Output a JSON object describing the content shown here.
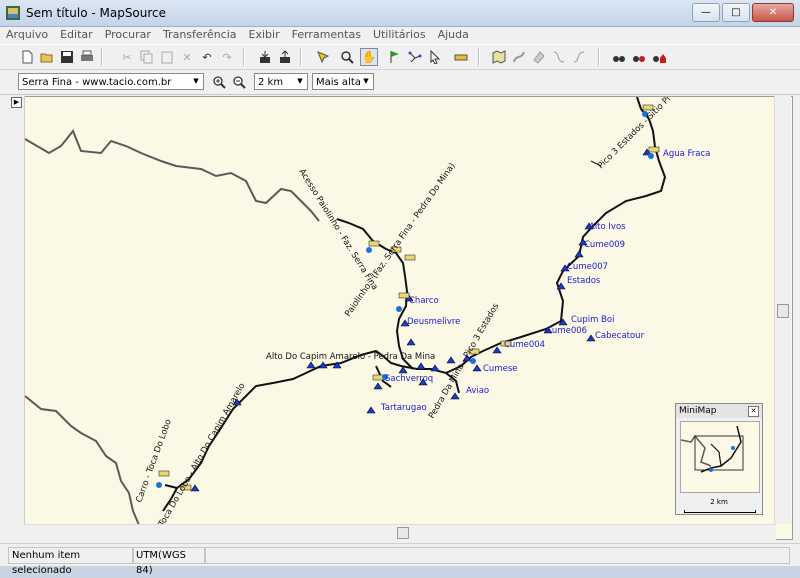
{
  "window": {
    "title": "Sem título - MapSource"
  },
  "menu": [
    "Arquivo",
    "Editar",
    "Procurar",
    "Transferência",
    "Exibir",
    "Ferramentas",
    "Utilitários",
    "Ajuda"
  ],
  "toolbar2": {
    "map_product": "Serra Fina - www.tacio.com.br",
    "zoom_scale": "2 km",
    "detail": "Mais alta"
  },
  "status": {
    "selection": "Nenhum item selecionado",
    "datum": "UTM(WGS 84)"
  },
  "minimap": {
    "title": "MiniMap",
    "scale": "2 km"
  },
  "waypoints": [
    "Agua Fraca",
    "Alto Ivos",
    "Cume009",
    "Cume007",
    "Estados",
    "Cupim Boi",
    "Cume006",
    "Cabecatour",
    "Cume004",
    "Cumese",
    "Aviao",
    "Tartarugao",
    "Sachverroq",
    "Charco",
    "Deusmelivre"
  ],
  "track_labels": {
    "pico3estados": "Pico 3 Estados - Sitio Pi",
    "acesso": "Acesso Paiolinho - Faz. Serra Fina",
    "paiolinho": "Paiolinho - (Faz. Serra Fina - Pedra Do Mina)",
    "capim": "Alto Do Capim Amarelo - Pedra Da Mina",
    "pedra3est": "Pedra Da Mina - Pico 3 Estados",
    "toca": "Toca Do Lobo - Alto Do Capim Amarelo",
    "carro": "Carro - Toca Do Lobo"
  },
  "colors": {
    "map_bg": "#fcf8e6",
    "track": "#111111",
    "border": "#5a5a5a",
    "waypoint": "#1a1ad0"
  }
}
